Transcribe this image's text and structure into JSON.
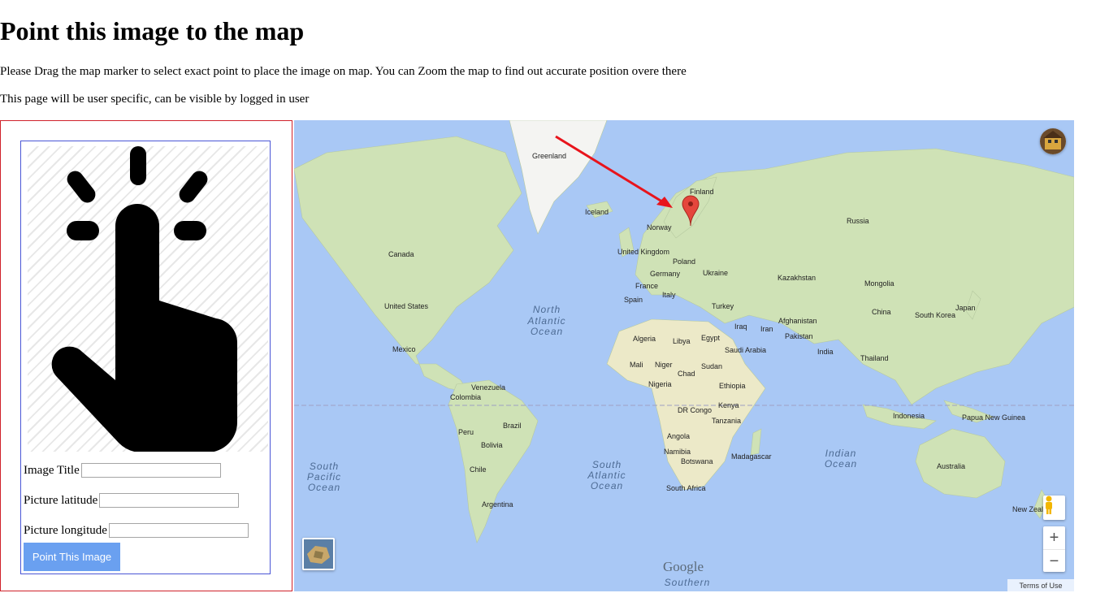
{
  "page": {
    "title": "Point this image to the map",
    "instruction": "Please Drag the map marker to select exact point to place the image on map. You can Zoom the map to find out accurate position overe there",
    "notice": "This page will be user specific, can be visible by logged in user"
  },
  "form": {
    "image_title_label": "Image Title",
    "image_title_value": "",
    "latitude_label": "Picture latitude",
    "latitude_value": "",
    "longitude_label": "Picture longitude",
    "longitude_value": "",
    "submit_label": "Point This Image",
    "illustration_icon": "tap-gesture-icon"
  },
  "map": {
    "labels": {
      "greenland": "Greenland",
      "iceland": "Iceland",
      "finland": "Finland",
      "norway": "Norway",
      "russia": "Russia",
      "uk": "United Kingdom",
      "canada": "Canada",
      "poland": "Poland",
      "germany": "Germany",
      "ukraine": "Ukraine",
      "france": "France",
      "spain": "Spain",
      "italy": "Italy",
      "kazakhstan": "Kazakhstan",
      "mongolia": "Mongolia",
      "us": "United States",
      "turkey": "Turkey",
      "china": "China",
      "south_korea": "South Korea",
      "japan": "Japan",
      "iraq": "Iraq",
      "iran": "Iran",
      "afghanistan": "Afghanistan",
      "pakistan": "Pakistan",
      "algeria": "Algeria",
      "libya": "Libya",
      "egypt": "Egypt",
      "saudi": "Saudi Arabia",
      "india": "India",
      "mexico": "Mexico",
      "thailand": "Thailand",
      "mali": "Mali",
      "niger": "Niger",
      "chad": "Chad",
      "sudan": "Sudan",
      "nigeria": "Nigeria",
      "ethiopia": "Ethiopia",
      "venezuela": "Venezuela",
      "colombia": "Colombia",
      "kenya": "Kenya",
      "drc": "DR Congo",
      "tanzania": "Tanzania",
      "indonesia": "Indonesia",
      "png": "Papua New Guinea",
      "peru": "Peru",
      "brazil": "Brazil",
      "bolivia": "Bolivia",
      "angola": "Angola",
      "namibia": "Namibia",
      "botswana": "Botswana",
      "madagascar": "Madagascar",
      "australia": "Australia",
      "chile": "Chile",
      "south_africa": "South Africa",
      "argentina": "Argentina",
      "new_zealand": "New Zealand"
    },
    "oceans": {
      "north_atlantic": [
        "North",
        "Atlantic",
        "Ocean"
      ],
      "south_pacific": [
        "South",
        "Pacific",
        "Ocean"
      ],
      "south_atlantic": [
        "South",
        "Atlantic",
        "Ocean"
      ],
      "indian": [
        "Indian",
        "Ocean"
      ],
      "southern": "Southern"
    },
    "zoom_in": "+",
    "zoom_out": "−",
    "attribution": "Google",
    "terms": "Terms of Use",
    "colors": {
      "water": "#a9c8f5",
      "land": "#cfe2b6",
      "marker": "#e5463c",
      "arrow": "#e8141c"
    }
  }
}
